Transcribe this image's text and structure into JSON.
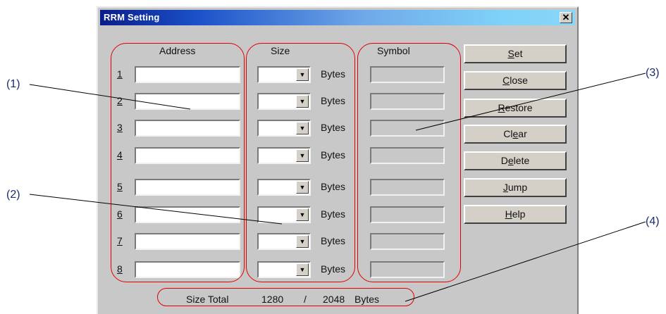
{
  "dialog": {
    "title": "RRM Setting",
    "close_label": "✕",
    "columns": {
      "address": "Address",
      "size": "Size",
      "symbol": "Symbol"
    },
    "bytes_label": "Bytes",
    "rows": [
      {
        "num": "1",
        "address": "",
        "size": "",
        "symbol": ""
      },
      {
        "num": "2",
        "address": "",
        "size": "",
        "symbol": ""
      },
      {
        "num": "3",
        "address": "",
        "size": "",
        "symbol": ""
      },
      {
        "num": "4",
        "address": "",
        "size": "",
        "symbol": ""
      },
      {
        "num": "5",
        "address": "",
        "size": "",
        "symbol": ""
      },
      {
        "num": "6",
        "address": "",
        "size": "",
        "symbol": ""
      },
      {
        "num": "7",
        "address": "",
        "size": "",
        "symbol": ""
      },
      {
        "num": "8",
        "address": "",
        "size": "",
        "symbol": ""
      }
    ],
    "buttons": [
      {
        "key": "S",
        "rest": "et",
        "pre": ""
      },
      {
        "key": "C",
        "rest": "lose",
        "pre": ""
      },
      {
        "key": "R",
        "rest": "estore",
        "pre": ""
      },
      {
        "key": "e",
        "rest": "ar",
        "pre": "Cl"
      },
      {
        "key": "e",
        "rest": "lete",
        "pre": "D"
      },
      {
        "key": "J",
        "rest": "ump",
        "pre": ""
      },
      {
        "key": "H",
        "rest": "elp",
        "pre": ""
      }
    ],
    "size_total": {
      "label": "Size Total",
      "used": "1280",
      "separator": "/",
      "max": "2048",
      "unit": "Bytes"
    }
  },
  "callouts": [
    "(1)",
    "(2)",
    "(3)",
    "(4)"
  ],
  "colors": {
    "annotation": "#e00000",
    "callout_text": "#1c2a6e",
    "dialog_bg": "#c8c8c8"
  }
}
